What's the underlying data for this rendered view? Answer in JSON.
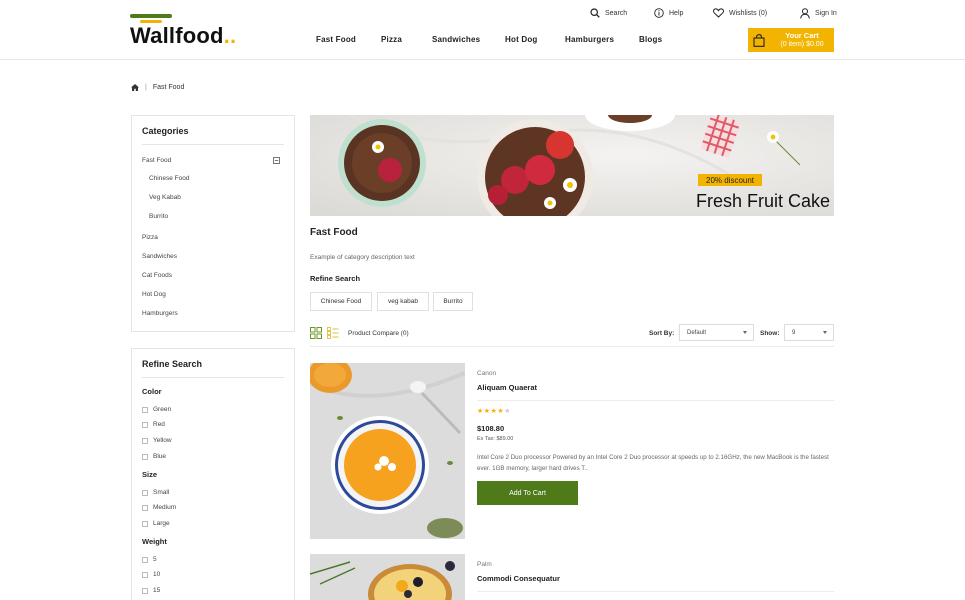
{
  "brand": {
    "name": "Wallfood",
    "dots": "..",
    "accent": "#4f7a1a",
    "yellow": "#f2b400"
  },
  "top_links": {
    "search": "Search",
    "help": "Help",
    "wishlist": "Wishlists (0)",
    "signin": "Sign In"
  },
  "nav": [
    "Fast Food",
    "Pizza",
    "Sandwiches",
    "Hot Dog",
    "Hamburgers",
    "Blogs"
  ],
  "cart": {
    "title": "Your Cart",
    "summary": "(0 item) $0.00",
    "icon": "shopping-bag-icon"
  },
  "breadcrumb": {
    "home_icon": "home-icon",
    "separator": "|",
    "current": "Fast Food"
  },
  "categories": {
    "title": "Categories",
    "items": [
      {
        "label": "Fast Food",
        "children": [
          "Chinese Food",
          "Veg Kabab",
          "Burrito"
        ]
      },
      {
        "label": "Pizza"
      },
      {
        "label": "Sandwiches"
      },
      {
        "label": "Cat Foods"
      },
      {
        "label": "Hot Dog"
      },
      {
        "label": "Hamburgers"
      }
    ]
  },
  "sidebar_refine": {
    "title": "Refine Search",
    "groups": [
      {
        "label": "Color",
        "options": [
          "Green",
          "Red",
          "Yellow",
          "Blue"
        ]
      },
      {
        "label": "Size",
        "options": [
          "Small",
          "Medium",
          "Large"
        ]
      },
      {
        "label": "Weight",
        "options": [
          "5",
          "10",
          "15"
        ]
      }
    ]
  },
  "banner": {
    "badge": "20% discount",
    "headline": "Fresh Fruit Cake"
  },
  "main": {
    "title": "Fast Food",
    "description": "Example of category description text",
    "refine_title": "Refine Search",
    "chips": [
      "Chinese Food",
      "veg kabab",
      "Burrito"
    ]
  },
  "toolbar": {
    "compare": "Product Compare (0)",
    "sort_label": "Sort By:",
    "sort_value": "Default",
    "show_label": "Show:",
    "show_value": "9"
  },
  "products": [
    {
      "brand": "Canon",
      "name": "Aliquam Quaerat",
      "rating": 4,
      "rating_max": 5,
      "price": "$108.80",
      "ex_tax": "Ex Tax: $89.00",
      "description": "Intel Core 2 Duo processor Powered by an Intel Core 2 Duo processor at speeds up to 2.16GHz, the new MacBook is the fastest ever. 1GB memory, larger hard drives T..",
      "button": "Add To Cart"
    },
    {
      "brand": "Palm",
      "name": "Commodi Consequatur"
    }
  ]
}
